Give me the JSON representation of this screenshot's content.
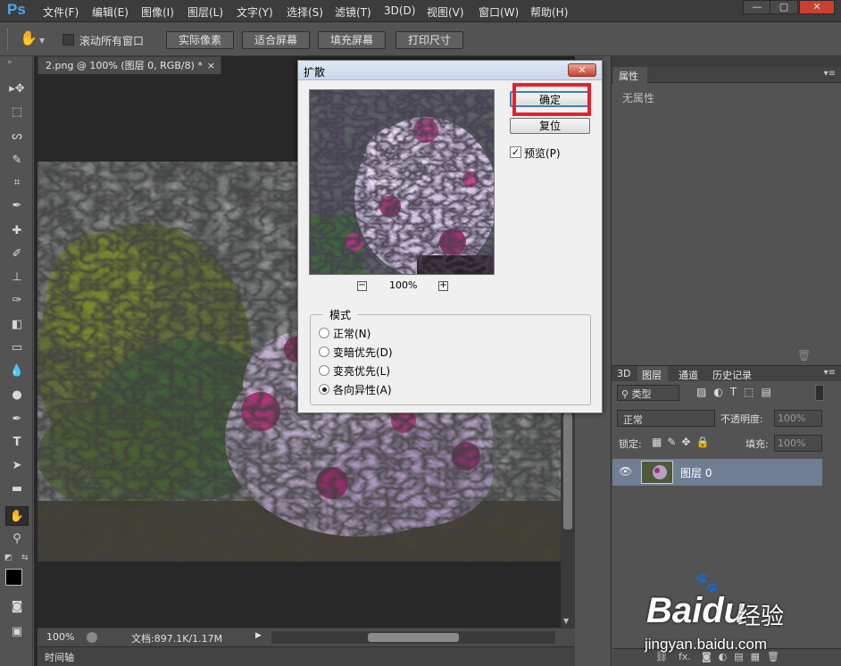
{
  "app": {
    "logo": "Ps"
  },
  "menu": [
    "文件(F)",
    "编辑(E)",
    "图像(I)",
    "图层(L)",
    "文字(Y)",
    "选择(S)",
    "滤镜(T)",
    "3D(D)",
    "视图(V)",
    "窗口(W)",
    "帮助(H)"
  ],
  "window_controls": [
    "—",
    "▢",
    "✕"
  ],
  "options": {
    "scroll_all_label": "滚动所有窗口",
    "buttons": [
      "实际像素",
      "适合屏幕",
      "填充屏幕",
      "打印尺寸"
    ]
  },
  "document": {
    "tab_title": "2.png @ 100% (图层 0, RGB/8) *",
    "tab_close": "×",
    "zoom": "100%",
    "doc_size": "文档:897.1K/1.17M",
    "timeline": "时间轴"
  },
  "properties": {
    "tab": "属性",
    "empty": "无属性"
  },
  "layers_panel": {
    "tabs": [
      "3D",
      "图层",
      "通道",
      "历史记录"
    ],
    "filter_kind": "类型",
    "blend_mode": "正常",
    "opacity_label": "不透明度:",
    "opacity_value": "100%",
    "lock_label": "锁定:",
    "fill_label": "填充:",
    "fill_value": "100%",
    "layers": [
      {
        "name": "图层 0"
      }
    ],
    "bottom_icons": [
      "fx."
    ]
  },
  "dialog": {
    "title": "扩散",
    "ok": "确定",
    "reset": "复位",
    "preview_label": "预览(P)",
    "preview_checked": true,
    "zoom": "100%",
    "mode_group": "模式",
    "modes": [
      {
        "label": "正常(N)",
        "selected": false
      },
      {
        "label": "变暗优先(D)",
        "selected": false
      },
      {
        "label": "变亮优先(L)",
        "selected": false
      },
      {
        "label": "各向异性(A)",
        "selected": true
      }
    ]
  },
  "watermark": {
    "brand": "Bai",
    "brand2": "du",
    "cn": "经验",
    "url": "jingyan.baidu.com"
  },
  "colors": {
    "highlight": "#e8202e",
    "ps_blue": "#4ea6ea",
    "selected_layer": "#6f7e93"
  }
}
